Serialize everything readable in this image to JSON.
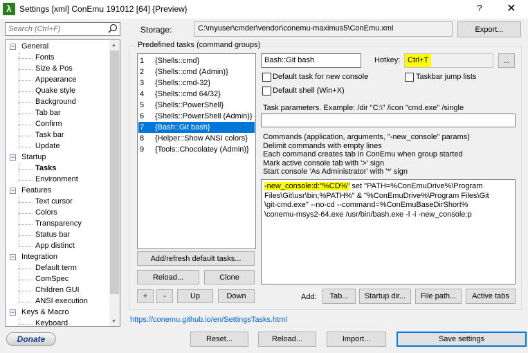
{
  "window": {
    "title": "Settings [xml] ConEmu 191012 [64] {Preview}",
    "app_icon_glyph": "λ",
    "help_glyph": "?",
    "close_glyph": "✕"
  },
  "search": {
    "placeholder": "Search (Ctrl+F)"
  },
  "tree": {
    "groups": [
      {
        "label": "General",
        "expander": "−",
        "children": [
          "Fonts",
          "Size & Pos",
          "Appearance",
          "Quake style",
          "Background",
          "Tab bar",
          "Confirm",
          "Task bar",
          "Update"
        ]
      },
      {
        "label": "Startup",
        "expander": "−",
        "children": [
          "Tasks",
          "Environment"
        ]
      },
      {
        "label": "Features",
        "expander": "−",
        "children": [
          "Text cursor",
          "Colors",
          "Transparency",
          "Status bar",
          "App distinct"
        ]
      },
      {
        "label": "Integration",
        "expander": "−",
        "children": [
          "Default term",
          "ComSpec",
          "Children GUI",
          "ANSI execution"
        ]
      },
      {
        "label": "Keys & Macro",
        "expander": "−",
        "children": [
          "Keyboard"
        ]
      }
    ],
    "selected": "Tasks"
  },
  "storage": {
    "label": "Storage:",
    "path": "C:\\myuser\\cmder\\vendor\\conemu-maximus5\\ConEmu.xml",
    "export_label": "Export..."
  },
  "tasks": {
    "group_title": "Predefined tasks (command groups)",
    "items": [
      {
        "num": "1",
        "name": "{Shells::cmd}"
      },
      {
        "num": "2",
        "name": "{Shells::cmd (Admin)}"
      },
      {
        "num": "3",
        "name": "{Shells::cmd-32}"
      },
      {
        "num": "4",
        "name": "{Shells::cmd 64/32}"
      },
      {
        "num": "5",
        "name": "{Shells::PowerShell}"
      },
      {
        "num": "6",
        "name": "{Shells::PowerShell (Admin)}"
      },
      {
        "num": "7",
        "name": "{Bash::Git bash}"
      },
      {
        "num": "8",
        "name": "{Helper::Show ANSI colors}"
      },
      {
        "num": "9",
        "name": "{Tools::Chocolatey (Admin)}"
      }
    ],
    "selected_index": 6,
    "add_refresh_label": "Add/refresh default tasks...",
    "reload_label": "Reload...",
    "clone_label": "Clone",
    "plus_label": "+",
    "minus_label": "-",
    "up_label": "Up",
    "down_label": "Down"
  },
  "task_detail": {
    "name": "Bash::Git bash",
    "hotkey_label": "Hotkey:",
    "hotkey": "Ctrl+T",
    "hotkey_more_label": "...",
    "default_task_label": "Default task for new console",
    "taskbar_jump_label": "Taskbar jump lists",
    "default_shell_label": "Default shell (Win+X)",
    "params_label": "Task parameters. Example: /dir \"C:\\\" /icon \"cmd.exe\" /single",
    "params_value": "",
    "commands_help": [
      "Commands (application, arguments, \"-new_console\" params)",
      "Delimit commands with empty lines",
      "Each command creates tab in ConEmu when group started",
      "Mark active console tab with '>' sign",
      "Start console 'As Administrator' with '*' sign"
    ],
    "command_highlight": "-new_console:d:\"%CD%\"",
    "command_lines": [
      " set \"PATH=%ConEmuDrive%\\Program",
      "Files\\Git\\usr\\bin;%PATH%\" & \"%ConEmuDrive%\\Program Files\\Git",
      "\\git-cmd.exe\" --no-cd --command=%ConEmuBaseDirShort%",
      "\\conemu-msys2-64.exe /usr/bin/bash.exe -l -i -new_console:p"
    ],
    "add_label": "Add:",
    "tab_label": "Tab...",
    "startup_dir_label": "Startup dir...",
    "file_path_label": "File path...",
    "active_tabs_label": "Active tabs"
  },
  "footer": {
    "link": "https://conemu.github.io/en/SettingsTasks.html",
    "donate_label": "Donate",
    "reset_label": "Reset...",
    "reload_label": "Reload...",
    "import_label": "Import...",
    "save_label": "Save settings"
  }
}
